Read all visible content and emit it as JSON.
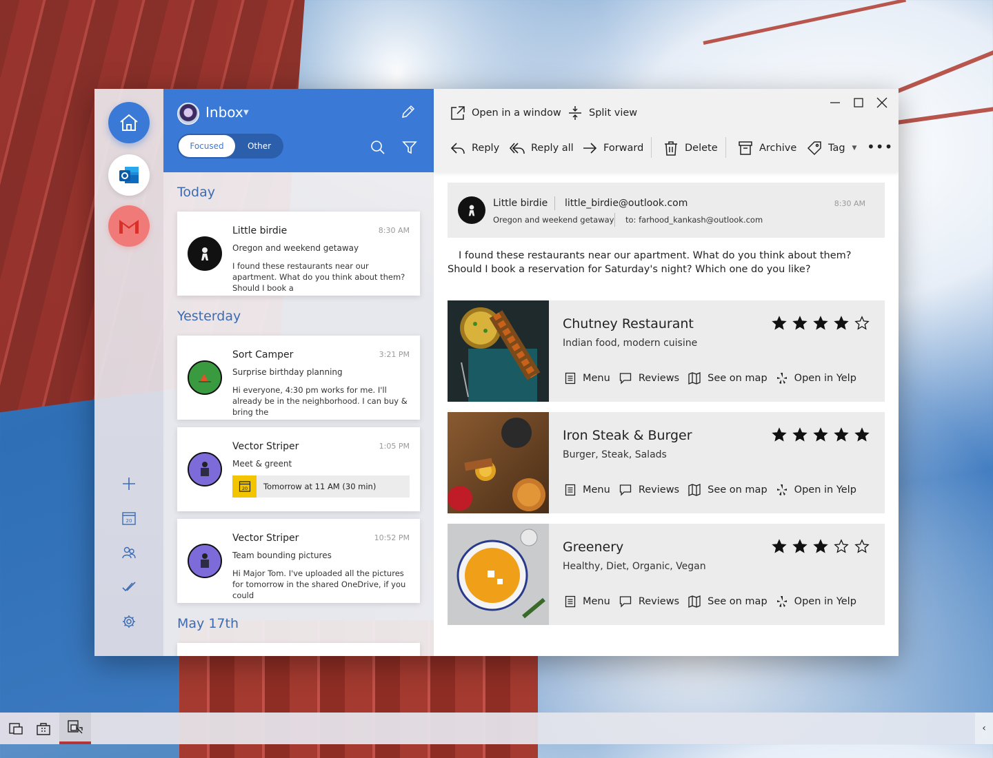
{
  "list": {
    "title": "Inbox",
    "tabs": {
      "focused": "Focused",
      "other": "Other"
    },
    "groups": {
      "today": "Today",
      "yesterday": "Yesterday",
      "may17": "May 17th"
    },
    "messages": [
      {
        "sender": "Little birdie",
        "time": "8:30 AM",
        "subject": "Oregon and weekend getaway",
        "preview": "I found these restaurants near our apartment. What do you think about them? Should I book a"
      },
      {
        "sender": "Sort Camper",
        "time": "3:21 PM",
        "subject": "Surprise birthday planning",
        "preview": "Hi everyone, 4:30 pm works for me. I'll already be in the neighborhood. I can buy & bring the"
      },
      {
        "sender": "Vector Striper",
        "time": "1:05 PM",
        "subject": "Meet & greent",
        "meeting": "Tomorrow at 11 AM (30 min)",
        "calendar_day": "20"
      },
      {
        "sender": "Vector Striper",
        "time": "10:52 PM",
        "subject": "Team bounding pictures",
        "preview": "Hi Major Tom. I've uploaded all the pictures for tomorrow in the shared OneDrive, if you could"
      }
    ]
  },
  "rail": {
    "calendar_day": "20"
  },
  "toolbar": {
    "open_window": "Open in a window",
    "split_view": "Split view",
    "reply": "Reply",
    "reply_all": "Reply all",
    "forward": "Forward",
    "delete": "Delete",
    "archive": "Archive",
    "tag": "Tag"
  },
  "message": {
    "sender": "Little birdie",
    "email": "little_birdie@outlook.com",
    "time": "8:30 AM",
    "subject": "Oregon and weekend getaway",
    "to": "to: farhood_kankash@outlook.com",
    "body": "I found these restaurants near our apartment. What do you think about them? Should I book a reservation for Saturday's night? Which one do you like?"
  },
  "restaurant_actions": {
    "menu": "Menu",
    "reviews": "Reviews",
    "map": "See on map",
    "yelp": "Open in Yelp"
  },
  "restaurants": [
    {
      "name": "Chutney Restaurant",
      "desc": "Indian food, modern cuisine",
      "rating": 4,
      "max_rating": 5
    },
    {
      "name": "Iron Steak & Burger",
      "desc": "Burger, Steak, Salads",
      "rating": 5,
      "max_rating": 5
    },
    {
      "name": "Greenery",
      "desc": "Healthy, Diet, Organic, Vegan",
      "rating": 3,
      "max_rating": 5
    }
  ],
  "colors": {
    "accent": "#3a7ad6",
    "gmail": "#f07a78",
    "calendar_badge": "#f3c500",
    "taskbar_active": "#b3353a"
  }
}
